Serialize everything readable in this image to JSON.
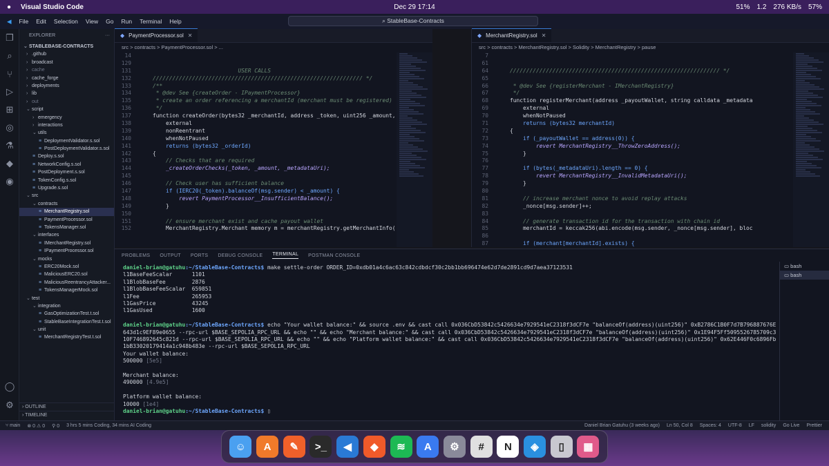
{
  "macbar": {
    "app_name": "Visual Studio Code",
    "datetime": "Dec 29  17:14",
    "cpu": "51%",
    "mem": "1.2",
    "net": "276 KB/s",
    "battery": "57%"
  },
  "titlebar": {
    "menus": [
      "File",
      "Edit",
      "Selection",
      "View",
      "Go",
      "Run",
      "Terminal",
      "Help"
    ],
    "command_center": "StableBase-Contracts"
  },
  "explorer": {
    "header": "EXPLORER",
    "root": "STABLEBASE-CONTRACTS",
    "items": [
      {
        "label": ".github",
        "depth": 0,
        "kind": "folder",
        "state": "closed"
      },
      {
        "label": "broadcast",
        "depth": 0,
        "kind": "folder",
        "state": "closed"
      },
      {
        "label": "cache",
        "depth": 0,
        "kind": "folder",
        "state": "closed",
        "dim": true
      },
      {
        "label": "cache_forge",
        "depth": 0,
        "kind": "folder",
        "state": "closed"
      },
      {
        "label": "deployments",
        "depth": 0,
        "kind": "folder",
        "state": "closed"
      },
      {
        "label": "lib",
        "depth": 0,
        "kind": "folder",
        "state": "closed"
      },
      {
        "label": "out",
        "depth": 0,
        "kind": "folder",
        "state": "closed",
        "dim": true
      },
      {
        "label": "script",
        "depth": 0,
        "kind": "folder",
        "state": "open"
      },
      {
        "label": "emergency",
        "depth": 1,
        "kind": "folder",
        "state": "closed"
      },
      {
        "label": "interactions",
        "depth": 1,
        "kind": "folder",
        "state": "closed"
      },
      {
        "label": "utils",
        "depth": 1,
        "kind": "folder",
        "state": "open"
      },
      {
        "label": "DeploymentValidator.s.sol",
        "depth": 2,
        "kind": "file"
      },
      {
        "label": "PostDeploymentValidator.s.sol",
        "depth": 2,
        "kind": "file"
      },
      {
        "label": "Deploy.s.sol",
        "depth": 1,
        "kind": "file"
      },
      {
        "label": "NetworkConfig.s.sol",
        "depth": 1,
        "kind": "file"
      },
      {
        "label": "PostDeployment.s.sol",
        "depth": 1,
        "kind": "file"
      },
      {
        "label": "TokenConfig.s.sol",
        "depth": 1,
        "kind": "file"
      },
      {
        "label": "Upgrade.s.sol",
        "depth": 1,
        "kind": "file"
      },
      {
        "label": "src",
        "depth": 0,
        "kind": "folder",
        "state": "open"
      },
      {
        "label": "contracts",
        "depth": 1,
        "kind": "folder",
        "state": "open"
      },
      {
        "label": "MerchantRegistry.sol",
        "depth": 2,
        "kind": "file",
        "selected": true
      },
      {
        "label": "PaymentProcessor.sol",
        "depth": 2,
        "kind": "file"
      },
      {
        "label": "TokensManager.sol",
        "depth": 2,
        "kind": "file"
      },
      {
        "label": "interfaces",
        "depth": 1,
        "kind": "folder",
        "state": "open"
      },
      {
        "label": "IMerchantRegistry.sol",
        "depth": 2,
        "kind": "file"
      },
      {
        "label": "IPaymentProcessor.sol",
        "depth": 2,
        "kind": "file"
      },
      {
        "label": "mocks",
        "depth": 1,
        "kind": "folder",
        "state": "open"
      },
      {
        "label": "ERC20Mock.sol",
        "depth": 2,
        "kind": "file"
      },
      {
        "label": "MaliciousERC20.sol",
        "depth": 2,
        "kind": "file"
      },
      {
        "label": "MaliciousReentrancyAttacker...",
        "depth": 2,
        "kind": "file"
      },
      {
        "label": "TokensManagerMock.sol",
        "depth": 2,
        "kind": "file"
      },
      {
        "label": "test",
        "depth": 0,
        "kind": "folder",
        "state": "open"
      },
      {
        "label": "integration",
        "depth": 1,
        "kind": "folder",
        "state": "open"
      },
      {
        "label": "GasOptimizationTest.t.sol",
        "depth": 2,
        "kind": "file"
      },
      {
        "label": "StableBaseIntegrationTest.t.sol",
        "depth": 2,
        "kind": "file"
      },
      {
        "label": "unit",
        "depth": 1,
        "kind": "folder",
        "state": "open"
      },
      {
        "label": "MerchantRegistryTest.t.sol",
        "depth": 2,
        "kind": "file"
      }
    ],
    "outline": "OUTLINE",
    "timeline": "TIMELINE"
  },
  "left_editor": {
    "tab": "PaymentProcessor.sol",
    "breadcrumb": "src > contracts > PaymentProcessor.sol > ...",
    "lines": [
      {
        "n": "14",
        "t": "",
        "c": "txt"
      },
      {
        "n": "129",
        "t": "",
        "c": "txt"
      },
      {
        "n": "131",
        "t": "                              USER CALLS",
        "c": "com"
      },
      {
        "n": "132",
        "t": "    //////////////////////////////////////////////////////////////// */",
        "c": "com"
      },
      {
        "n": "133",
        "t": "    /**",
        "c": "com"
      },
      {
        "n": "134",
        "t": "     * @dev See {createOrder - IPaymentProcessor}",
        "c": "com"
      },
      {
        "n": "135",
        "t": "     * create an order referencing a merchantId (merchant must be registered)",
        "c": "com"
      },
      {
        "n": "136",
        "t": "     */",
        "c": "com"
      },
      {
        "n": "137",
        "t": "    function createOrder(bytes32 _merchantId, address _token, uint256 _amount,",
        "c": "fnline"
      },
      {
        "n": "138",
        "t": "        external",
        "c": "txt"
      },
      {
        "n": "139",
        "t": "        nonReentrant",
        "c": "txt"
      },
      {
        "n": "140",
        "t": "        whenNotPaused",
        "c": "txt"
      },
      {
        "n": "141",
        "t": "        returns (bytes32 _orderId)",
        "c": "key"
      },
      {
        "n": "142",
        "t": "    {",
        "c": "txt"
      },
      {
        "n": "143",
        "t": "        // Checks that are required",
        "c": "com"
      },
      {
        "n": "144",
        "t": "        _createOrderChecks(_token, _amount, _metadataUri);",
        "c": "fn"
      },
      {
        "n": "145",
        "t": "",
        "c": "txt"
      },
      {
        "n": "146",
        "t": "        // Check user has sufficient balance",
        "c": "com"
      },
      {
        "n": "147",
        "t": "        if (IERC20(_token).balanceOf(msg.sender) < _amount) {",
        "c": "key"
      },
      {
        "n": "148",
        "t": "            revert PaymentProcessor__InsufficientBalance();",
        "c": "fn"
      },
      {
        "n": "149",
        "t": "        }",
        "c": "txt"
      },
      {
        "n": "150",
        "t": "",
        "c": "txt"
      },
      {
        "n": "151",
        "t": "        // ensure merchant exist and cache payout wallet",
        "c": "com"
      },
      {
        "n": "152",
        "t": "        MerchantRegistry.Merchant memory m = merchantRegistry.getMerchantInfo(",
        "c": "txt"
      }
    ]
  },
  "right_editor": {
    "tab": "MerchantRegistry.sol",
    "breadcrumb": "src > contracts > MerchantRegistry.sol > Solidity > MerchantRegistry > pause",
    "lines": [
      {
        "n": "7",
        "t": "",
        "c": "txt"
      },
      {
        "n": "61",
        "t": "",
        "c": "txt"
      },
      {
        "n": "64",
        "t": "    //////////////////////////////////////////////////////////////// */",
        "c": "com"
      },
      {
        "n": "65",
        "t": "",
        "c": "txt"
      },
      {
        "n": "66",
        "t": "     * @dev See {registerMerchant - IMerchantRegistry}",
        "c": "com"
      },
      {
        "n": "67",
        "t": "     */",
        "c": "com"
      },
      {
        "n": "68",
        "t": "    function registerMerchant(address _payoutWallet, string calldata _metadata",
        "c": "fnline"
      },
      {
        "n": "69",
        "t": "        external",
        "c": "txt"
      },
      {
        "n": "70",
        "t": "        whenNotPaused",
        "c": "txt"
      },
      {
        "n": "71",
        "t": "        returns (bytes32 merchantId)",
        "c": "key"
      },
      {
        "n": "72",
        "t": "    {",
        "c": "txt"
      },
      {
        "n": "73",
        "t": "        if (_payoutWallet == address(0)) {",
        "c": "key"
      },
      {
        "n": "74",
        "t": "            revert MerchantRegistry__ThrowZeroAddress();",
        "c": "fn"
      },
      {
        "n": "75",
        "t": "        }",
        "c": "txt"
      },
      {
        "n": "76",
        "t": "",
        "c": "txt"
      },
      {
        "n": "77",
        "t": "        if (bytes(_metadataUri).length == 0) {",
        "c": "key"
      },
      {
        "n": "78",
        "t": "            revert MerchantRegistry__InvalidMetadataUri();",
        "c": "fn"
      },
      {
        "n": "79",
        "t": "        }",
        "c": "txt"
      },
      {
        "n": "80",
        "t": "",
        "c": "txt"
      },
      {
        "n": "81",
        "t": "        // increase merchant nonce to avoid replay attacks",
        "c": "com"
      },
      {
        "n": "82",
        "t": "        _nonce[msg.sender]++;",
        "c": "txt"
      },
      {
        "n": "83",
        "t": "",
        "c": "txt"
      },
      {
        "n": "84",
        "t": "        // generate transaction id for the transaction with chain id",
        "c": "com"
      },
      {
        "n": "85",
        "t": "        merchantId = keccak256(abi.encode(msg.sender, _nonce[msg.sender], bloc",
        "c": "txt"
      },
      {
        "n": "86",
        "t": "",
        "c": "txt"
      },
      {
        "n": "87",
        "t": "        if (merchant[merchantId].exists) {",
        "c": "key"
      }
    ]
  },
  "panel": {
    "tabs": [
      "PROBLEMS",
      "OUTPUT",
      "PORTS",
      "DEBUG CONSOLE",
      "TERMINAL",
      "POSTMAN CONSOLE"
    ],
    "active_tab": "TERMINAL",
    "shells": [
      "bash",
      "bash"
    ],
    "terminal": [
      {
        "type": "prompt",
        "user": "daniel-brian@gatuhu",
        "path": ":~/StableBase-Contracts$",
        "cmd": " make settle-order ORDER_ID=0xdb01a4c6ac63c842cdbdcf30c2bb1bb696474e62d7de2891cd9d7aea37123531"
      },
      {
        "type": "out",
        "text": "l1BaseFeeScalar      1101"
      },
      {
        "type": "out",
        "text": "l1BlobBaseFee        2876"
      },
      {
        "type": "out",
        "text": "l1BlobBaseFeeScalar  659851"
      },
      {
        "type": "out",
        "text": "l1Fee                265953"
      },
      {
        "type": "out",
        "text": "l1GasPrice           43245"
      },
      {
        "type": "out",
        "text": "l1GasUsed            1600"
      },
      {
        "type": "out",
        "text": ""
      },
      {
        "type": "prompt",
        "user": "daniel-brian@gatuhu",
        "path": ":~/StableBase-Contracts$",
        "cmd": " echo \"Your wallet balance:\" && source .env && cast call 0x036CbD53842c5426634e7929541eC2318f3dCF7e \"balanceOf(address)(uint256)\" 0xB2786C1B0F7d7B796887676E643d1c9EF89e0655 --rpc-url $BASE_SEPOLIA_RPC_URL && echo \"\" && echo \"Merchant balance:\" && cast call 0x036CbD53842c5426634e7929541eC2318f3dCF7e \"balanceOf(address)(uint256)\" 0x1E94F5Ff5095526785709c310F746892645c821d --rpc-url $BASE_SEPOLIA_RPC_URL && echo \"\" && echo \"Platform wallet balance:\" && cast call 0x036CbD53842c5426634e7929541eC2318f3dCF7e \"balanceOf(address)(uint256)\" 0x62E446F0c6896Fb1bB33020179414a1c948b483e --rpc-url $BASE_SEPOLIA_RPC_URL"
      },
      {
        "type": "out",
        "text": "Your wallet balance:"
      },
      {
        "type": "val",
        "text": "500000",
        "dim": " [5e5]"
      },
      {
        "type": "out",
        "text": ""
      },
      {
        "type": "out",
        "text": "Merchant balance:"
      },
      {
        "type": "val",
        "text": "490000",
        "dim": " [4.9e5]"
      },
      {
        "type": "out",
        "text": ""
      },
      {
        "type": "out",
        "text": "Platform wallet balance:"
      },
      {
        "type": "val",
        "text": "10000",
        "dim": " [1e4]"
      },
      {
        "type": "prompt",
        "user": "daniel-brian@gatuhu",
        "path": ":~/StableBase-Contracts$",
        "cmd": " "
      }
    ]
  },
  "statusbar": {
    "branch": "main",
    "problems": "⊗ 0 ⚠ 0",
    "ports": "0",
    "coding_time": "3 hrs 5 mins Coding, 34 mins AI Coding",
    "blame": "Daniel Brian Gatuhu (3 weeks ago)",
    "position": "Ln 50, Col 8",
    "spaces": "Spaces: 4",
    "encoding": "UTF-8",
    "eol": "LF",
    "language": "solidity",
    "live": "Go Live",
    "prettier": "Prettier"
  },
  "dock": [
    "Finder",
    "App Store",
    "Pen",
    "Terminal",
    "VS Code",
    "Brave",
    "Spotify",
    "TestFlight",
    "System Settings",
    "Slack",
    "Notion",
    "Docker",
    "Trash",
    "Launchpad"
  ]
}
